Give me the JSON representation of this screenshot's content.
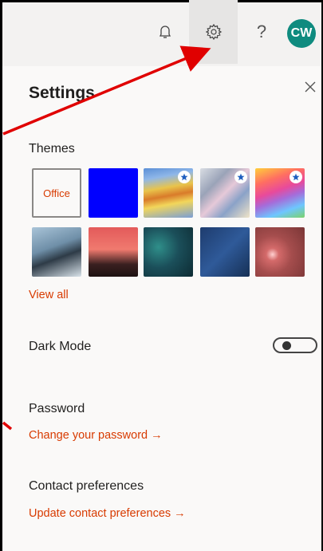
{
  "topbar": {
    "notification_icon": "bell-icon",
    "settings_icon": "gear-icon",
    "help_icon": "question-icon",
    "avatar_initials": "CW"
  },
  "panel": {
    "title": "Settings",
    "close_icon": "close-icon"
  },
  "themes": {
    "heading": "Themes",
    "office_label": "Office",
    "view_all": "View all",
    "items": [
      "office",
      "blue",
      "rainbow-stripes",
      "silver-waves",
      "unicorn",
      "mountain",
      "palms",
      "circuit",
      "innovation",
      "bokeh"
    ]
  },
  "dark_mode": {
    "label": "Dark Mode",
    "enabled": false
  },
  "password": {
    "heading": "Password",
    "link": "Change your password →"
  },
  "contact": {
    "heading": "Contact preferences",
    "link": "Update contact preferences →"
  },
  "colors": {
    "accent": "#d83b01",
    "avatar": "#0f8b7f",
    "annotation_arrow": "#e00000"
  }
}
